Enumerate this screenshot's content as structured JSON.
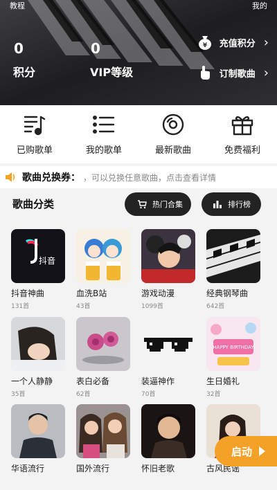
{
  "header": {
    "top_left": "教程",
    "top_right": "我的",
    "points": {
      "value": "0",
      "label": "积分"
    },
    "vip": {
      "value": "0",
      "label": "VIP等级"
    },
    "recharge_label": "充值积分",
    "order_label": "订制歌曲"
  },
  "quicknav": {
    "items": [
      {
        "label": "已购歌单",
        "icon": "purchased-music-icon"
      },
      {
        "label": "我的歌单",
        "icon": "list-icon"
      },
      {
        "label": "最新歌曲",
        "icon": "disc-icon"
      },
      {
        "label": "免费福利",
        "icon": "gift-icon"
      }
    ]
  },
  "banner": {
    "title": "歌曲兑换券：",
    "text": "，可以兑换任意歌曲，点击查看详情"
  },
  "categories": {
    "title": "歌曲分类",
    "hot_label": "热门合集",
    "rank_label": "排行榜",
    "items": [
      {
        "name": "抖音神曲",
        "count": "131首"
      },
      {
        "name": "血洗B站",
        "count": "43首"
      },
      {
        "name": "游戏动漫",
        "count": "1099首"
      },
      {
        "name": "经典钢琴曲",
        "count": "642首"
      },
      {
        "name": "一个人静静",
        "count": "35首"
      },
      {
        "name": "表白必备",
        "count": "62首"
      },
      {
        "name": "装逼神作",
        "count": "70首"
      },
      {
        "name": "生日婚礼",
        "count": "32首"
      },
      {
        "name": "华语流行",
        "count": ""
      },
      {
        "name": "国外流行",
        "count": ""
      },
      {
        "name": "怀旧老歌",
        "count": ""
      },
      {
        "name": "古风民谣",
        "count": ""
      }
    ]
  },
  "tiktok_logo_text": "抖音",
  "birthday_text": "HAPPY BIRTHDAY",
  "start_label": "启动",
  "colors": {
    "accent": "#f4a128",
    "pill": "#232323",
    "header": "#2f2f33"
  }
}
